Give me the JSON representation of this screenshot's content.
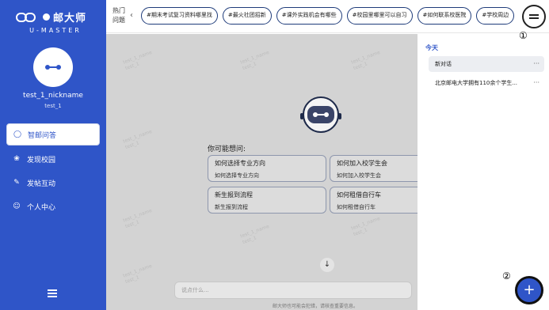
{
  "brand": {
    "name_cn": "邮大师",
    "name_en": "U-MASTER"
  },
  "user": {
    "nickname": "test_1_nickname",
    "id": "test_1"
  },
  "nav": [
    {
      "label": "智邮问答",
      "icon": "chat-bubble-icon",
      "active": true
    },
    {
      "label": "发现校园",
      "icon": "campus-icon",
      "active": false
    },
    {
      "label": "发帖互动",
      "icon": "edit-icon",
      "active": false
    },
    {
      "label": "个人中心",
      "icon": "user-icon",
      "active": false
    }
  ],
  "topbar": {
    "hot_label": "热门问题",
    "chips": [
      "#期末考试复习资料哪里找",
      "#最火社团招新",
      "#课外实践机会有哪些",
      "#校园里哪里可以自习",
      "#如何联系校医院",
      "#学校周边"
    ]
  },
  "chat": {
    "watermark": "test_1_name\ntest_1",
    "maybe_label": "你可能想问:",
    "suggestions": [
      {
        "title": "如何选择专业方向",
        "sub": "如何选择专业方向"
      },
      {
        "title": "如何加入校学生会",
        "sub": "如何加入校学生会"
      },
      {
        "title": "新生报到流程",
        "sub": "新生报到流程"
      },
      {
        "title": "如何租借自行车",
        "sub": "如何租借自行车"
      }
    ],
    "input_placeholder": "说点什么...",
    "disclaimer": "邮大师也可能会犯错，请核查重要信息。"
  },
  "history": {
    "group_label": "今天",
    "items": [
      {
        "label": "新对话",
        "active": true,
        "more": "···"
      },
      {
        "label": "北京邮电大学拥有110余个学生...",
        "active": false,
        "more": "···"
      }
    ]
  },
  "annotations": {
    "menu_marker": "①",
    "fab_marker": "②"
  },
  "colors": {
    "primary": "#2f55c8",
    "chat_bg": "#d3d3d3"
  }
}
